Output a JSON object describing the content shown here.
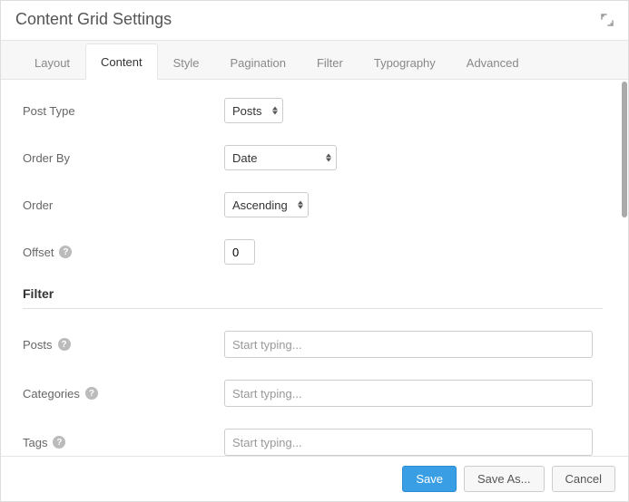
{
  "header": {
    "title": "Content Grid Settings"
  },
  "tabs": {
    "layout": "Layout",
    "content": "Content",
    "style": "Style",
    "pagination": "Pagination",
    "filter": "Filter",
    "typography": "Typography",
    "advanced": "Advanced"
  },
  "fields": {
    "post_type": {
      "label": "Post Type",
      "value": "Posts"
    },
    "order_by": {
      "label": "Order By",
      "value": "Date"
    },
    "order": {
      "label": "Order",
      "value": "Ascending"
    },
    "offset": {
      "label": "Offset",
      "value": "0"
    }
  },
  "filter": {
    "heading": "Filter",
    "posts": {
      "label": "Posts",
      "placeholder": "Start typing..."
    },
    "categories": {
      "label": "Categories",
      "placeholder": "Start typing..."
    },
    "tags": {
      "label": "Tags",
      "placeholder": "Start typing..."
    }
  },
  "footer": {
    "save": "Save",
    "save_as": "Save As...",
    "cancel": "Cancel"
  }
}
